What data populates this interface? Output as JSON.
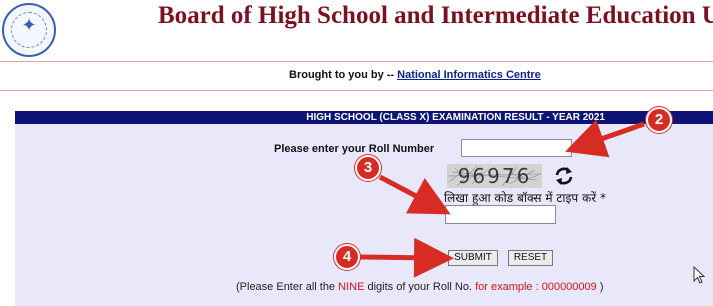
{
  "header": {
    "title": "Board of High School and Intermediate Education U.P.",
    "logo_icon": "up-board-emblem-icon"
  },
  "credits": {
    "prefix": "Brought to you by -- ",
    "link": "National Informatics Centre"
  },
  "panel": {
    "heading": "HIGH SCHOOL (CLASS X)  EXAMINATION RESULT - YEAR 2021",
    "roll_label": "Please enter your Roll Number",
    "roll_value": "",
    "captcha_code": "96976",
    "refresh_icon": "refresh-icon",
    "captcha_label": "लिखा हुआ कोड बॉक्स में टाइप करें",
    "captcha_required": " *",
    "captcha_value": "",
    "submit_label": "SUBMIT",
    "reset_label": "RESET",
    "note": {
      "part1": "(Please Enter all the ",
      "nine": "NINE",
      "part2": " digits of your Roll No. ",
      "example_label": "for example :",
      "example_value": " 000000009",
      "part3": " )"
    }
  },
  "annotations": {
    "c2": "2",
    "c3": "3",
    "c4": "4"
  },
  "colors": {
    "title": "#7a1020",
    "panel_head": "#0c1576",
    "panel_bg": "#e9e8fb",
    "callout": "#d62c24",
    "link": "#0a1f8f"
  }
}
